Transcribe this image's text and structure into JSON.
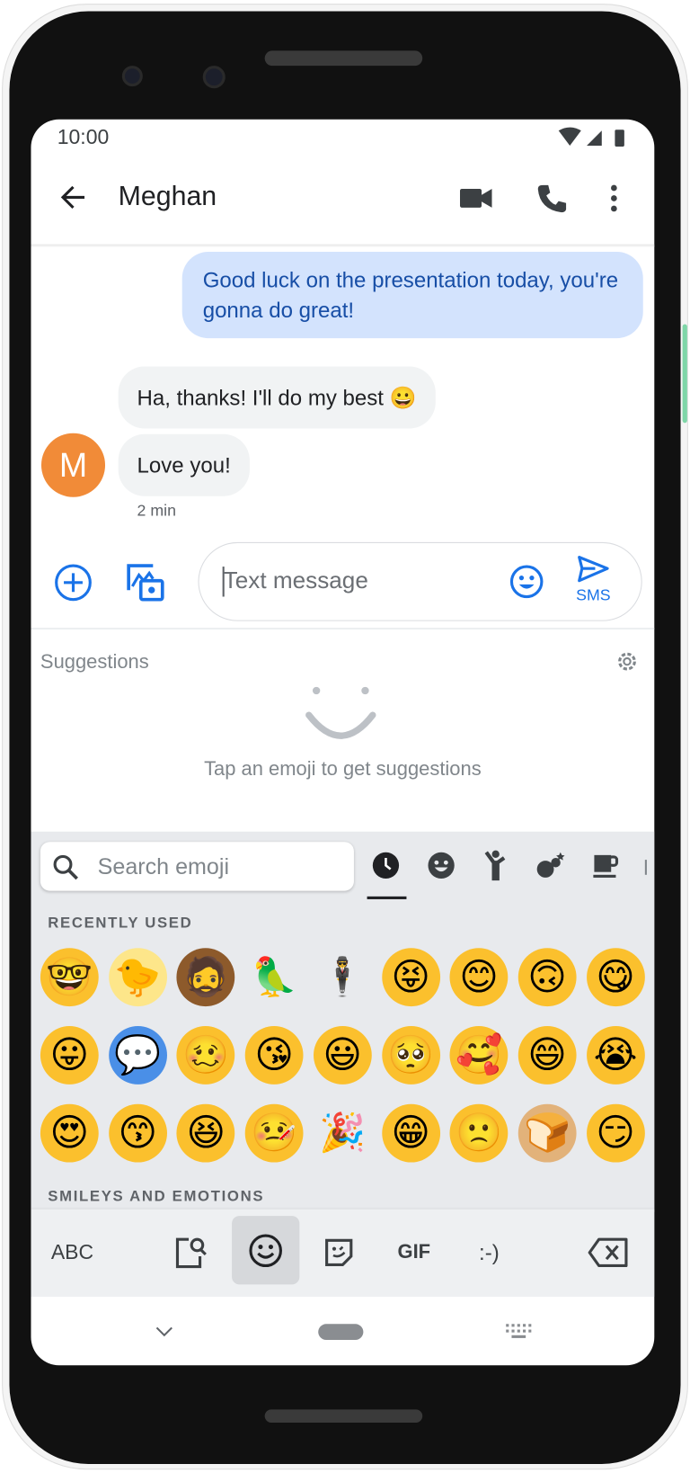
{
  "status_bar": {
    "time": "10:00"
  },
  "app_bar": {
    "title": "Meghan",
    "icons": [
      "back-arrow-icon",
      "video-call-icon",
      "phone-icon",
      "more-vert-icon"
    ]
  },
  "messages": [
    {
      "direction": "outgoing",
      "text": "Good luck on the presentation today, you're gonna do great!"
    },
    {
      "direction": "incoming",
      "text": "Ha, thanks! I'll do my best 😀"
    },
    {
      "direction": "incoming",
      "text": "Love you!"
    }
  ],
  "avatar": {
    "letter": "M",
    "color": "#f18b38"
  },
  "timestamp": "2 min",
  "compose": {
    "placeholder": "Text message",
    "send_label": "SMS"
  },
  "suggestions": {
    "title": "Suggestions",
    "hint": "Tap an emoji to get suggestions"
  },
  "emoji_keyboard": {
    "search_placeholder": "Search emoji",
    "categories": [
      "recent-clock-icon",
      "smileys-icon",
      "people-icon",
      "animals-nature-icon",
      "food-drink-icon"
    ],
    "recently_used_label": "RECENTLY USED",
    "recently_used": [
      [
        "🤓",
        "🐤",
        "🧔",
        "🦜",
        "🕴",
        "😝",
        "😊",
        "🙃",
        "😋"
      ],
      [
        "😛",
        "💬",
        "🥴",
        "😘",
        "😃",
        "🥺",
        "🥰",
        "😄",
        "😭"
      ],
      [
        "😍",
        "😙",
        "😆",
        "🤒",
        "🎉",
        "😁",
        "🙁",
        "🍞",
        "😏"
      ]
    ],
    "next_section_label": "SMILEYS AND EMOTIONS",
    "toolbar": {
      "abc": "ABC",
      "gif": "GIF",
      "emoticon": ":-)"
    }
  },
  "colors": {
    "accent": "#1a73e8",
    "outgoing_bubble": "#d3e3fd",
    "incoming_bubble": "#f1f3f4",
    "keyboard_bg": "#e8eaed"
  }
}
